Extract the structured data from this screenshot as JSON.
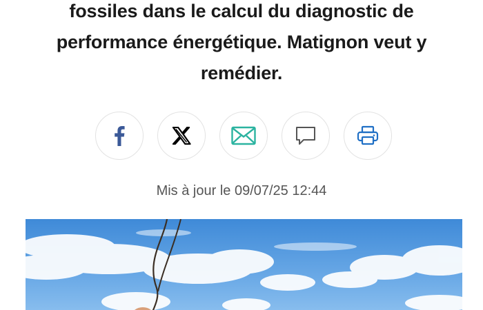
{
  "article": {
    "headline_line1": "fossiles dans le calcul du diagnostic de",
    "headline_line2": "performance énergétique. Matignon veut y",
    "headline_line3": "remédier.",
    "updated": "Mis à jour le 09/07/25 12:44"
  },
  "share": {
    "facebook_glyph": "f",
    "x_glyph": "𝕏",
    "icons": [
      "facebook-icon",
      "x-icon",
      "mail-icon",
      "comment-icon",
      "print-icon"
    ]
  },
  "colors": {
    "facebook": "#3b5998",
    "x": "#000000",
    "mail": "#2bb3a0",
    "comment": "#555555",
    "print": "#1f6fc5",
    "sky": "#4a90d9"
  }
}
